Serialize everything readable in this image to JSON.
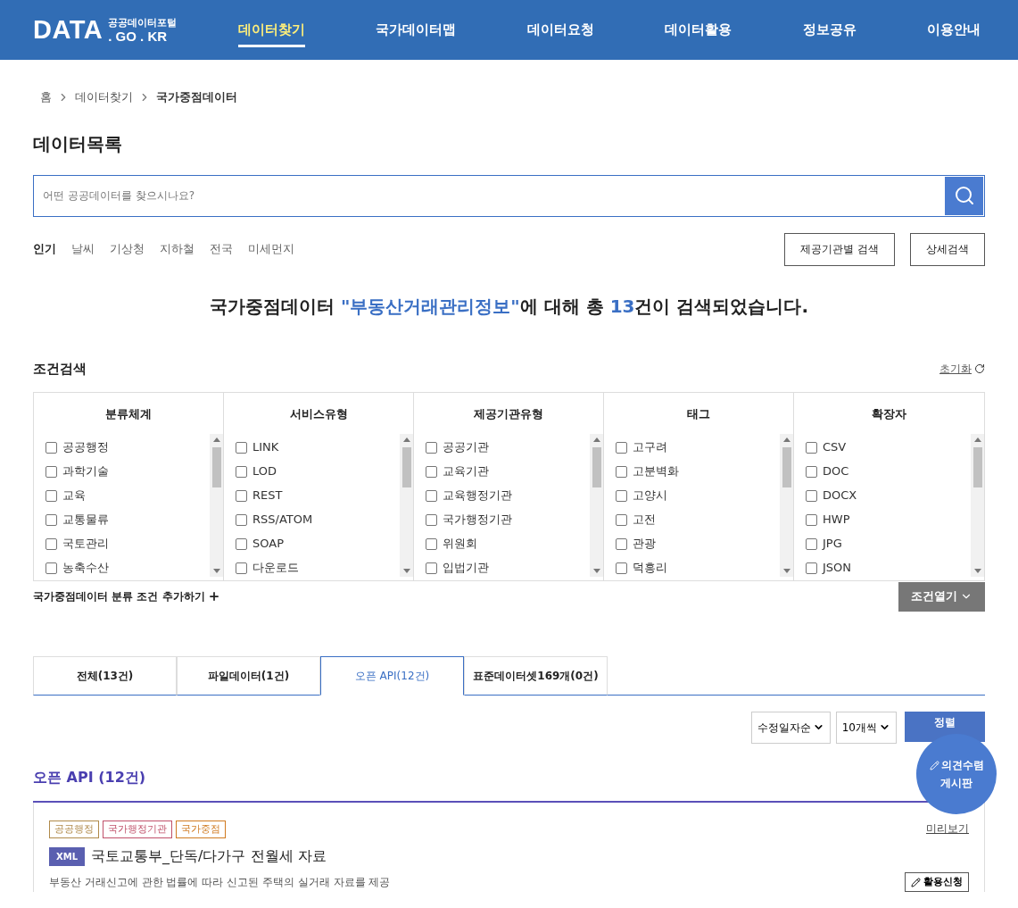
{
  "header": {
    "logo": "DATA",
    "logo_sub": "공공데이터포털",
    "logo_domain": ". GO . KR",
    "nav": [
      {
        "label": "데이터찾기",
        "selected": true
      },
      {
        "label": "국가데이터맵",
        "selected": false
      },
      {
        "label": "데이터요청",
        "selected": false
      },
      {
        "label": "데이터활용",
        "selected": false
      },
      {
        "label": "정보공유",
        "selected": false
      },
      {
        "label": "이용안내",
        "selected": false
      }
    ]
  },
  "breadcrumb": [
    "홈",
    "데이터찾기",
    "국가중점데이터"
  ],
  "page_title": "데이터목록",
  "search": {
    "placeholder": "어떤 공공데이터를 찾으시나요?"
  },
  "popular": {
    "label": "인기",
    "keywords": [
      "날씨",
      "기상청",
      "지하철",
      "전국",
      "미세먼지"
    ]
  },
  "search_buttons": [
    "제공기관별 검색",
    "상세검색"
  ],
  "result_parts": {
    "prefix": "국가중점데이터 ",
    "query": "\"부동산거래관리정보\"",
    "middle": "에 대해 총 ",
    "count": "13",
    "suffix": "건이 검색되었습니다."
  },
  "filter": {
    "title": "조건검색",
    "reset": "초기화",
    "columns": [
      {
        "title": "분류체계",
        "options": [
          {
            "label": "공공행정",
            "checked": false
          },
          {
            "label": "과학기술",
            "checked": false
          },
          {
            "label": "교육",
            "checked": false
          },
          {
            "label": "교통물류",
            "checked": false
          },
          {
            "label": "국토관리",
            "checked": false
          },
          {
            "label": "농축수산",
            "checked": false
          }
        ]
      },
      {
        "title": "서비스유형",
        "options": [
          {
            "label": "LINK",
            "checked": false
          },
          {
            "label": "LOD",
            "checked": false
          },
          {
            "label": "REST",
            "checked": false
          },
          {
            "label": "RSS/ATOM",
            "checked": false
          },
          {
            "label": "SOAP",
            "checked": false
          },
          {
            "label": "다운로드",
            "checked": false
          }
        ]
      },
      {
        "title": "제공기관유형",
        "options": [
          {
            "label": "공공기관",
            "checked": false
          },
          {
            "label": "교육기관",
            "checked": false
          },
          {
            "label": "교육행정기관",
            "checked": false
          },
          {
            "label": "국가행정기관",
            "checked": false
          },
          {
            "label": "위원회",
            "checked": false
          },
          {
            "label": "입법기관",
            "checked": false
          }
        ]
      },
      {
        "title": "태그",
        "options": [
          {
            "label": "고구려",
            "checked": false
          },
          {
            "label": "고분벽화",
            "checked": false
          },
          {
            "label": "고양시",
            "checked": false
          },
          {
            "label": "고전",
            "checked": false
          },
          {
            "label": "관광",
            "checked": false
          },
          {
            "label": "덕흥리",
            "checked": false
          }
        ]
      },
      {
        "title": "확장자",
        "options": [
          {
            "label": "CSV",
            "checked": false
          },
          {
            "label": "DOC",
            "checked": false
          },
          {
            "label": "DOCX",
            "checked": false
          },
          {
            "label": "HWP",
            "checked": false
          },
          {
            "label": "JPG",
            "checked": false
          },
          {
            "label": "JSON",
            "checked": false
          }
        ]
      }
    ],
    "add_condition": "국가중점데이터 분류 조건 추가하기",
    "open_button": "조건열기"
  },
  "tabs": [
    {
      "label": "전체(13건)",
      "selected": false
    },
    {
      "label": "파일데이터(1건)",
      "selected": false
    },
    {
      "label": "오픈 API(12건)",
      "selected": true
    },
    {
      "label": "표준데이터셋169개(0건)",
      "selected": false
    }
  ],
  "sort": {
    "order": "수정일자순",
    "page_size": "10개씩",
    "button": "정렬"
  },
  "feedback_button": [
    "의견수렴",
    "게시판"
  ],
  "section_title": "오픈 API (12건)",
  "results": [
    {
      "tags": [
        {
          "label": "공공행정",
          "color": "#b08a4a"
        },
        {
          "label": "국가행정기관",
          "color": "#c0506a"
        },
        {
          "label": "국가중점",
          "color": "#d07a20"
        }
      ],
      "preview": "미리보기",
      "format": "XML",
      "title": "국토교통부_단독/다가구 전월세 자료",
      "description": "부동산 거래신고에 관한 법률에 따라 신고된 주택의 실거래 자료를 제공",
      "apply": "활용신청"
    }
  ]
}
